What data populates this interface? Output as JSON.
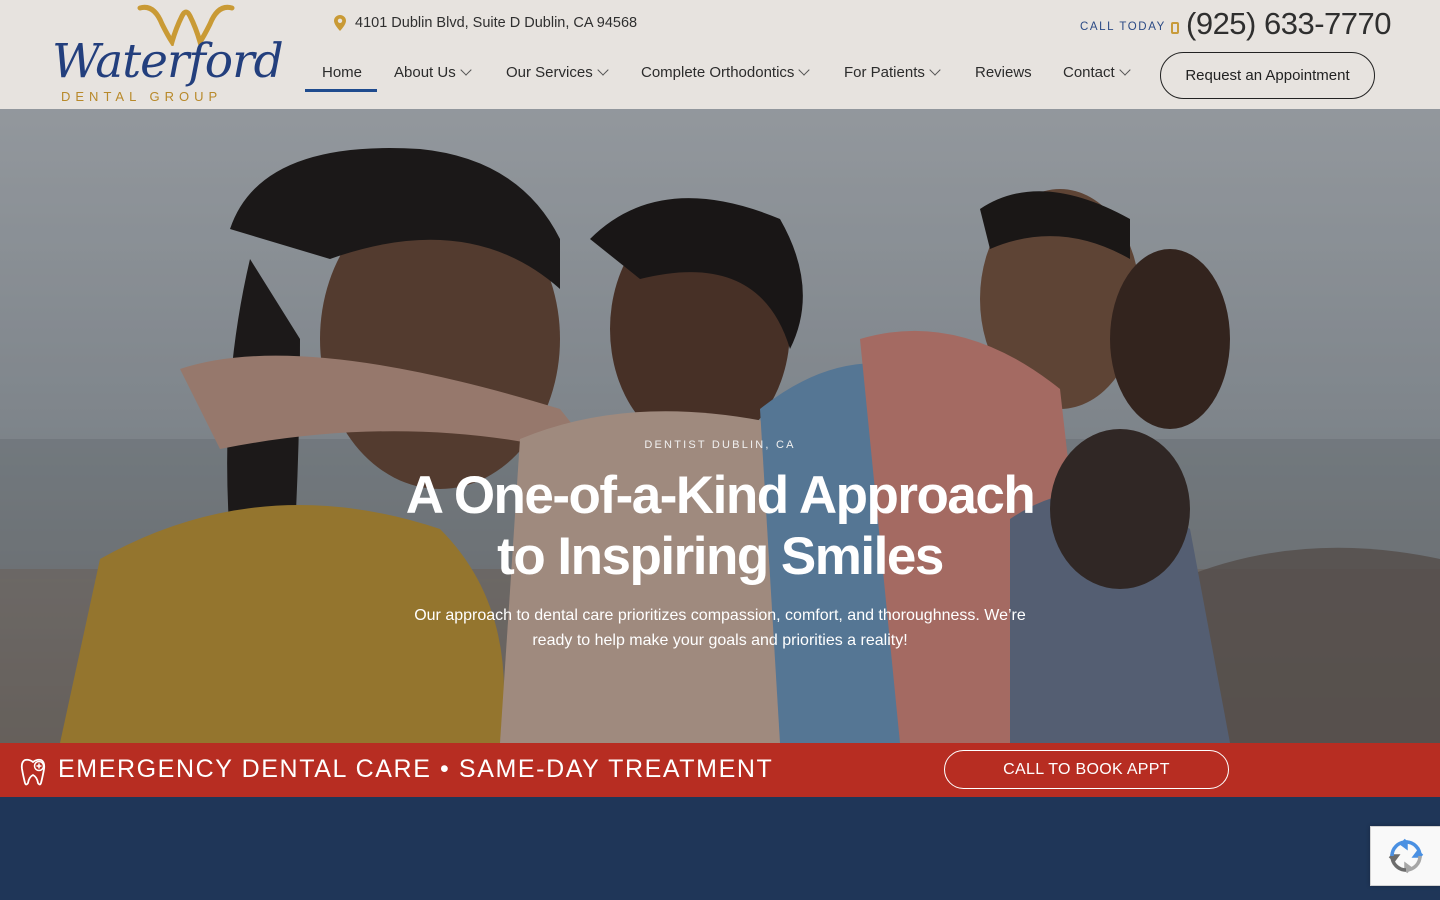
{
  "logo": {
    "word": "Waterford",
    "sub": "DENTAL GROUP"
  },
  "address": "4101 Dublin Blvd, Suite D Dublin, CA 94568",
  "call": {
    "label": "CALL TODAY",
    "phone": "(925) 633-7770"
  },
  "nav": {
    "items": [
      {
        "label": "Home",
        "active": true
      },
      {
        "label": "About Us",
        "dropdown": true
      },
      {
        "label": "Our Services",
        "dropdown": true
      },
      {
        "label": "Complete Orthodontics",
        "dropdown": true
      },
      {
        "label": "For Patients",
        "dropdown": true
      },
      {
        "label": "Reviews"
      },
      {
        "label": "Contact",
        "dropdown": true
      }
    ],
    "cta": "Request an Appointment"
  },
  "hero": {
    "eyebrow": "DENTIST DUBLIN, CA",
    "headline_1": "A One-of-a-Kind Approach",
    "headline_2": "to Inspiring Smiles",
    "subtext_1": "Our approach to dental care prioritizes compassion, comfort, and thoroughness. We’re",
    "subtext_2": "ready to help make your goals and priorities a reality!"
  },
  "emergency": {
    "text": "EMERGENCY DENTAL CARE • SAME-DAY TREATMENT",
    "button": "CALL TO BOOK APPT"
  },
  "colors": {
    "header_bg": "#e7e3df",
    "brand_blue": "#233f7d",
    "brand_gold": "#b8892a",
    "emergency_red": "#b72d22",
    "footer_navy": "#1f3658"
  },
  "icons": [
    "map-pin-icon",
    "phone-icon",
    "chevron-down-icon",
    "tooth-icon",
    "recaptcha-icon"
  ]
}
